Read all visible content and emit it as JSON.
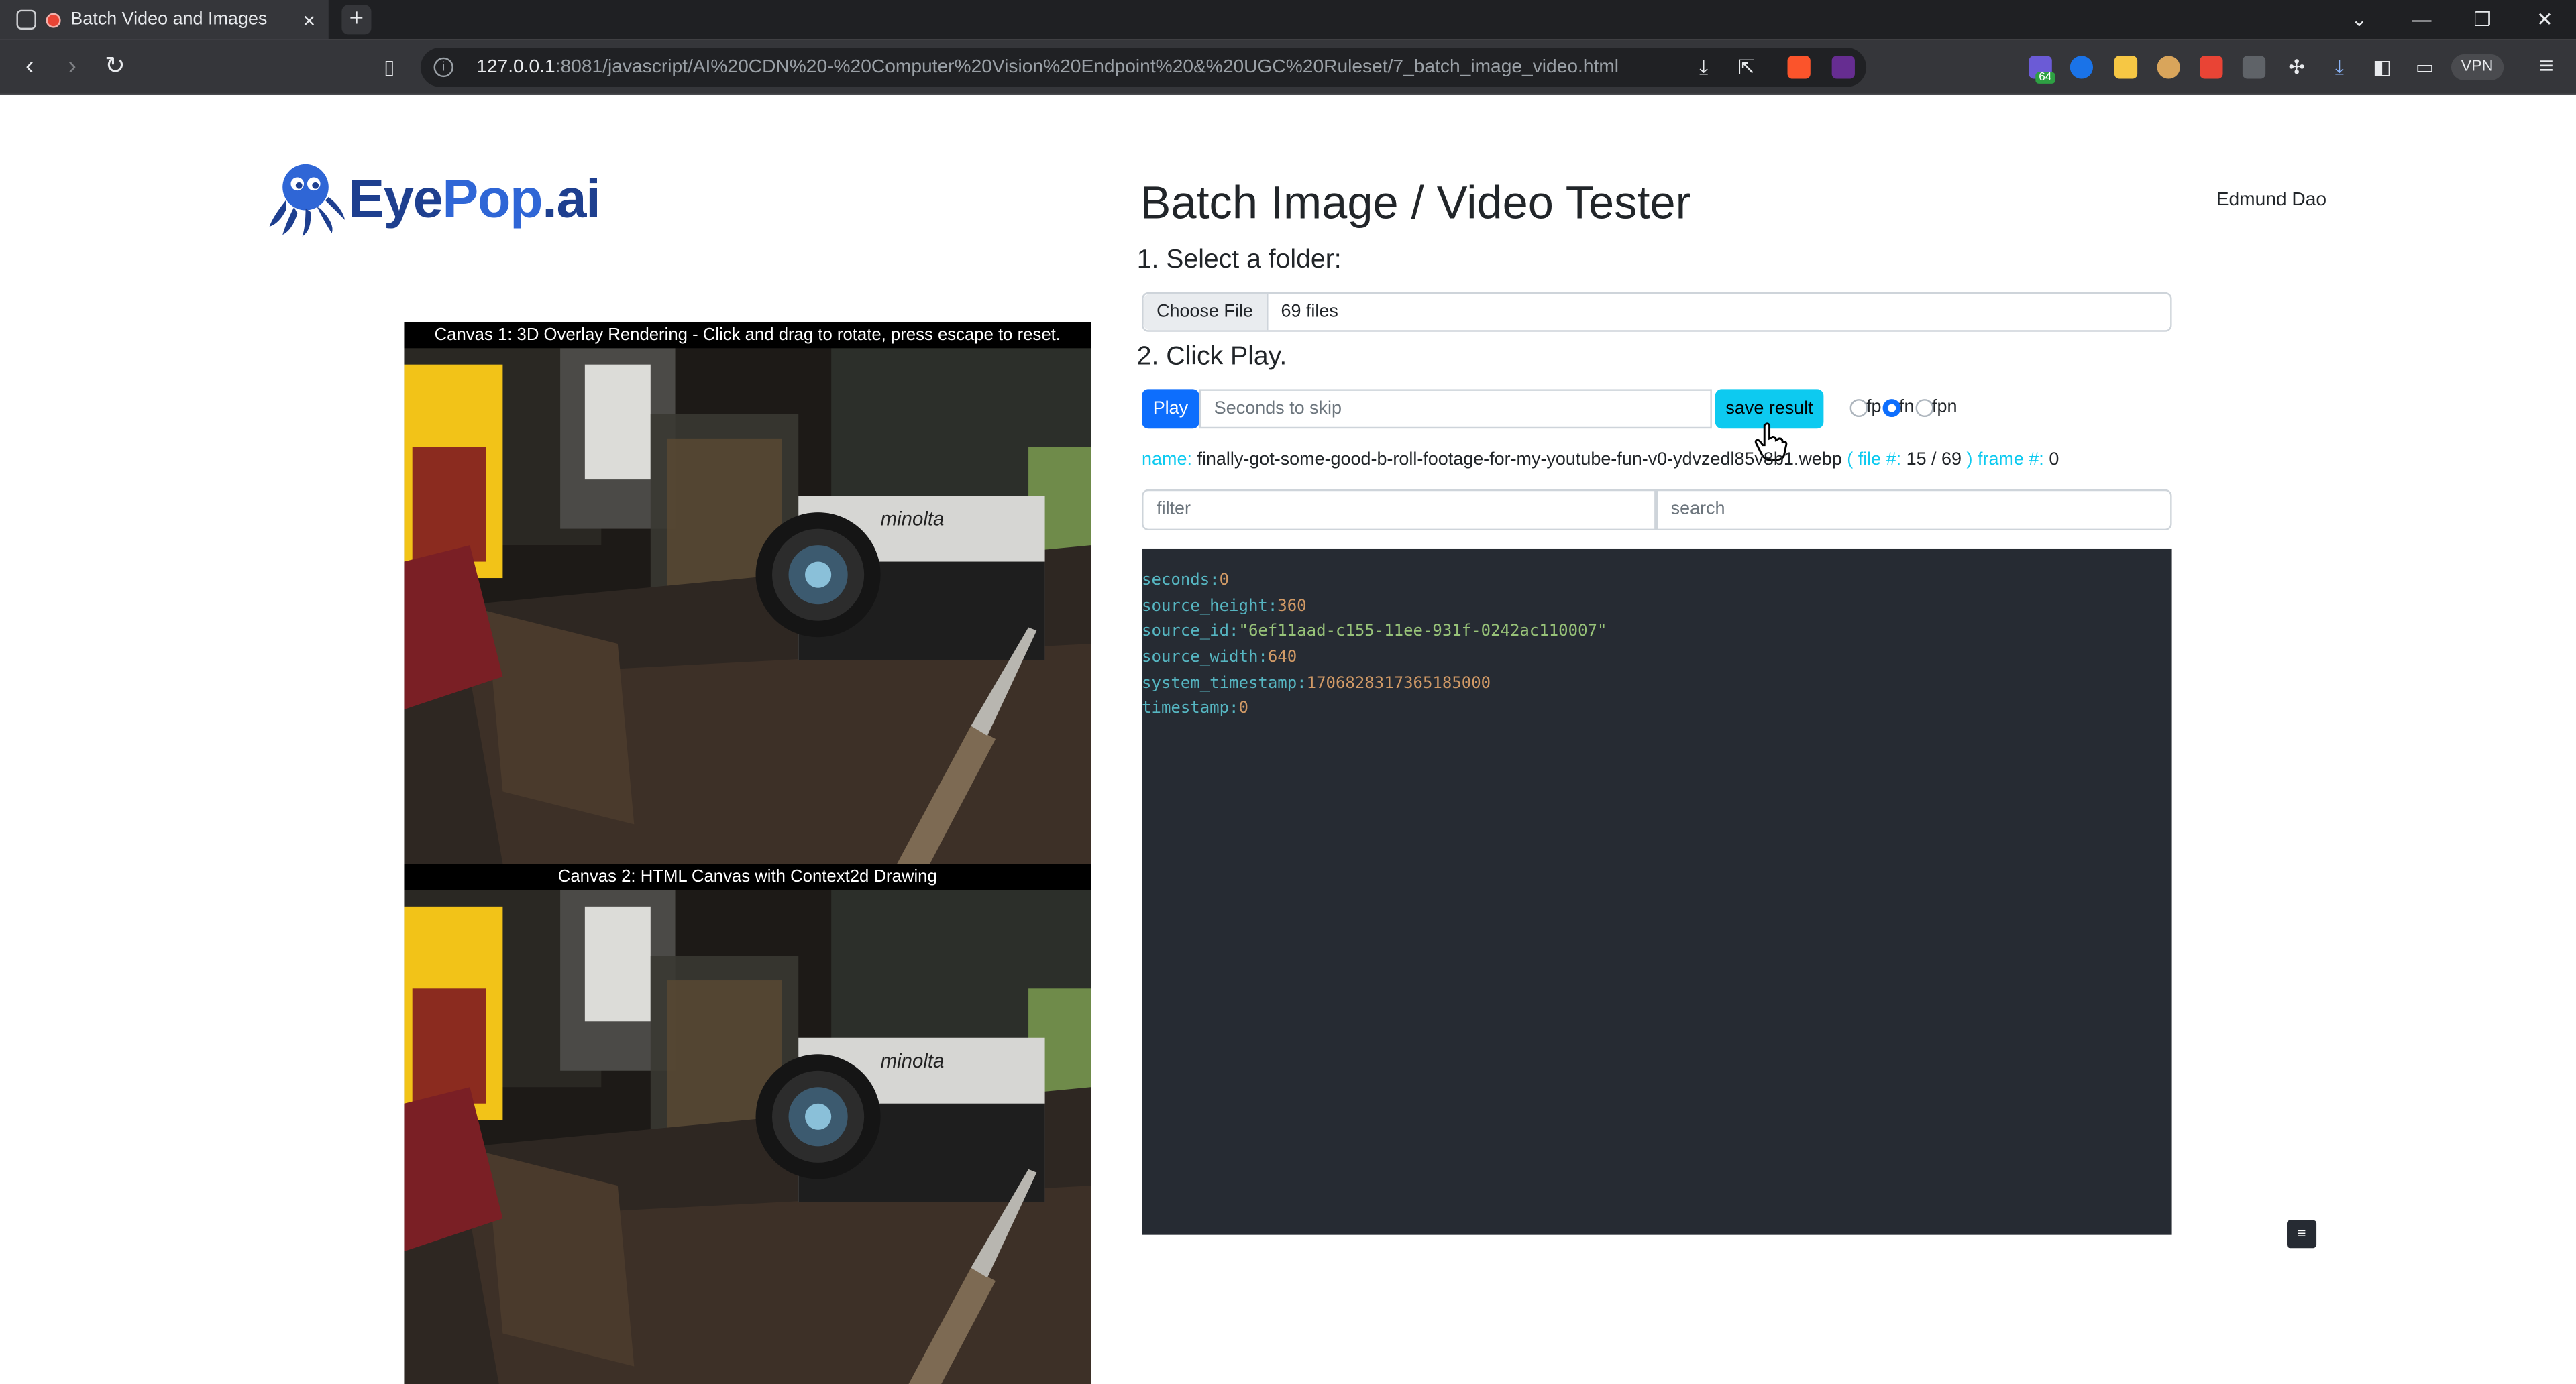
{
  "browser": {
    "tab_title": "Batch Video and Images",
    "tab_close": "×",
    "new_tab": "+",
    "url_host": "127.0.0.1",
    "url_rest": ":8081/javascript/AI%20CDN%20-%20Computer%20Vision%20Endpoint%20&%20UGC%20Ruleset/7_batch_image_video.html",
    "vpn_label": "VPN",
    "ext_badge": "64",
    "icons": [
      "back-icon",
      "forward-icon",
      "reload-icon",
      "bookmark-icon",
      "info-icon",
      "download-icon",
      "share-icon",
      "brave-shield-icon",
      "brave-rewards-icon",
      "extensions-icon",
      "sidebar-icon",
      "wallet-icon",
      "menu-icon"
    ]
  },
  "header": {
    "logo_eye": "Eye",
    "logo_pop": "Pop",
    "logo_ai": ".ai",
    "title": "Batch Image / Video Tester",
    "user_name": "Edmund Dao"
  },
  "steps": {
    "step1": "1. Select a folder:",
    "step2": "2. Click Play."
  },
  "file_input": {
    "button_label": "Choose File",
    "value": "69 files"
  },
  "controls": {
    "play_label": "Play",
    "skip_placeholder": "Seconds to skip",
    "save_label": "save result",
    "radios": [
      {
        "label": "fp",
        "checked": false
      },
      {
        "label": "fn",
        "checked": true
      },
      {
        "label": "fpn",
        "checked": false
      }
    ]
  },
  "status": {
    "name_key": "name:",
    "name_value": "finally-got-some-good-b-roll-footage-for-my-youtube-fun-v0-ydvzedl85v8b1.webp",
    "file_key_open": "( file #:",
    "file_value": "15 / 69",
    "file_key_close": ")",
    "frame_key": "frame #:",
    "frame_value": "0"
  },
  "filters": {
    "filter_placeholder": "filter",
    "search_placeholder": "search"
  },
  "json_output": [
    {
      "key": "seconds:",
      "value": "0",
      "type": "n"
    },
    {
      "key": "source_height:",
      "value": "360",
      "type": "n"
    },
    {
      "key": "source_id:",
      "value": "\"6ef11aad-c155-11ee-931f-0242ac110007\"",
      "type": "s"
    },
    {
      "key": "source_width:",
      "value": "640",
      "type": "n"
    },
    {
      "key": "system_timestamp:",
      "value": "1706828317365185000",
      "type": "n"
    },
    {
      "key": "timestamp:",
      "value": "0",
      "type": "n"
    }
  ],
  "menu_button": "≡",
  "canvas1": {
    "caption": "Canvas 1: 3D Overlay Rendering - Click and drag to rotate, press escape to reset."
  },
  "canvas2": {
    "caption": "Canvas 2: HTML Canvas with Context2d Drawing"
  },
  "scene": {
    "camera_brand": "minolta"
  },
  "colors": {
    "primary": "#0d6efd",
    "info": "#0dcaf0",
    "json_bg": "#262b33",
    "logo_dark": "#1e3f8f",
    "logo_light": "#2f66d6"
  }
}
